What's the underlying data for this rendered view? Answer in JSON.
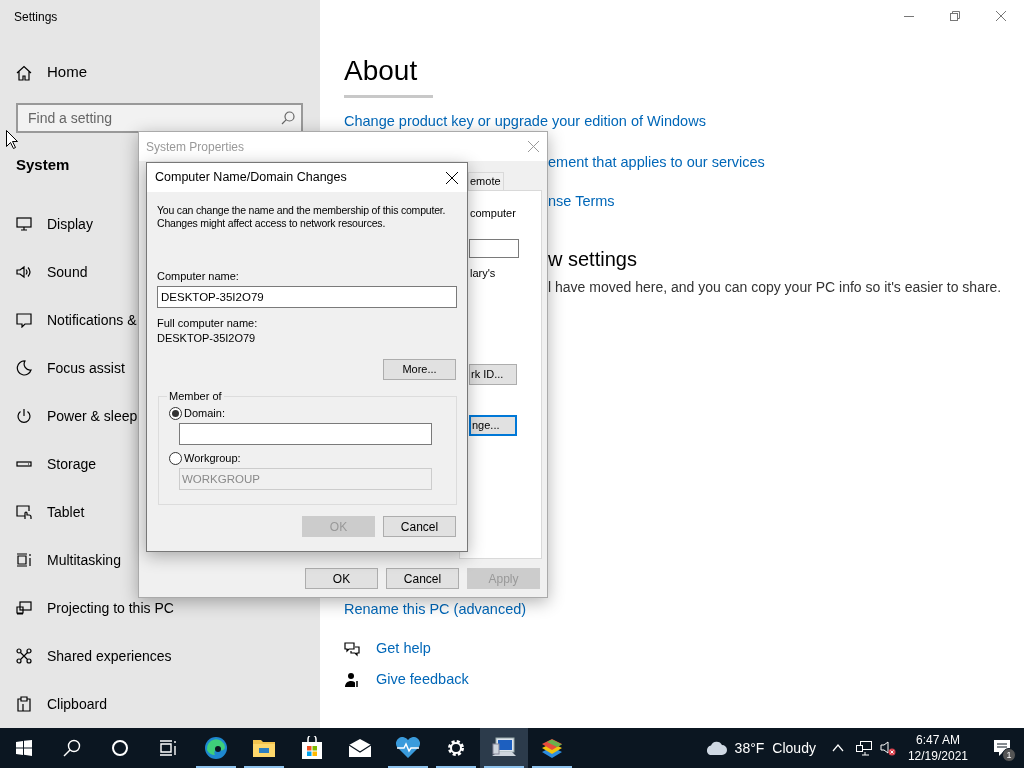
{
  "settings_window": {
    "title": "Settings",
    "sidebar": {
      "home": "Home",
      "search": {
        "placeholder": "Find a setting"
      },
      "section": "System",
      "items": [
        {
          "label": "Display"
        },
        {
          "label": "Sound"
        },
        {
          "label": "Notifications &"
        },
        {
          "label": "Focus assist"
        },
        {
          "label": "Power & sleep"
        },
        {
          "label": "Storage"
        },
        {
          "label": "Tablet"
        },
        {
          "label": "Multitasking"
        },
        {
          "label": "Projecting to this PC"
        },
        {
          "label": "Shared experiences"
        },
        {
          "label": "Clipboard"
        }
      ]
    },
    "content": {
      "heading": "About",
      "links": [
        "Change product key or upgrade your edition of Windows",
        "ement that applies to our services",
        "nse Terms"
      ],
      "section_heading": "w settings",
      "section_text": "l have moved here, and you can copy your PC info so it's easier to share.",
      "rename_link": "Rename this PC (advanced)",
      "help_links": [
        "Get help",
        "Give feedback"
      ]
    }
  },
  "system_properties": {
    "title": "System Properties",
    "tab": "emote",
    "texts": [
      "computer",
      "lary's"
    ],
    "panel_buttons": [
      {
        "label": "rk ID...",
        "focused": false
      },
      {
        "label": "nge...",
        "focused": true
      }
    ],
    "buttons": [
      {
        "label": "OK",
        "disabled": false
      },
      {
        "label": "Cancel",
        "disabled": false
      },
      {
        "label": "Apply",
        "disabled": true
      }
    ]
  },
  "name_dialog": {
    "title": "Computer Name/Domain Changes",
    "description": "You can change the name and the membership of this computer. Changes might affect access to network resources.",
    "computer_name_label": "Computer name:",
    "computer_name": "DESKTOP-35I2O79",
    "full_name_label": "Full computer name:",
    "full_name": "DESKTOP-35I2O79",
    "more_button": "More...",
    "member_of": {
      "label": "Member of",
      "options": [
        {
          "label": "Domain:",
          "selected": true,
          "disabled": false
        },
        {
          "label": "Workgroup:",
          "selected": false,
          "value": "WORKGROUP",
          "disabled": true
        }
      ]
    },
    "buttons": [
      {
        "label": "OK",
        "disabled": true
      },
      {
        "label": "Cancel",
        "disabled": false
      }
    ]
  },
  "taskbar": {
    "apps": [
      {
        "running": false,
        "selected": false
      },
      {
        "running": false,
        "selected": false
      },
      {
        "running": false,
        "selected": false
      },
      {
        "running": false,
        "selected": false
      },
      {
        "running": true,
        "selected": false
      },
      {
        "running": true,
        "selected": false
      },
      {
        "running": false,
        "selected": false
      },
      {
        "running": false,
        "selected": false
      },
      {
        "running": true,
        "selected": false
      },
      {
        "running": true,
        "selected": false
      },
      {
        "running": true,
        "selected": true
      },
      {
        "running": true,
        "selected": false
      }
    ],
    "weather": {
      "temperature": "38°F",
      "condition": "Cloudy"
    },
    "time": "6:47 AM",
    "date": "12/19/2021",
    "notification_count": "1"
  }
}
